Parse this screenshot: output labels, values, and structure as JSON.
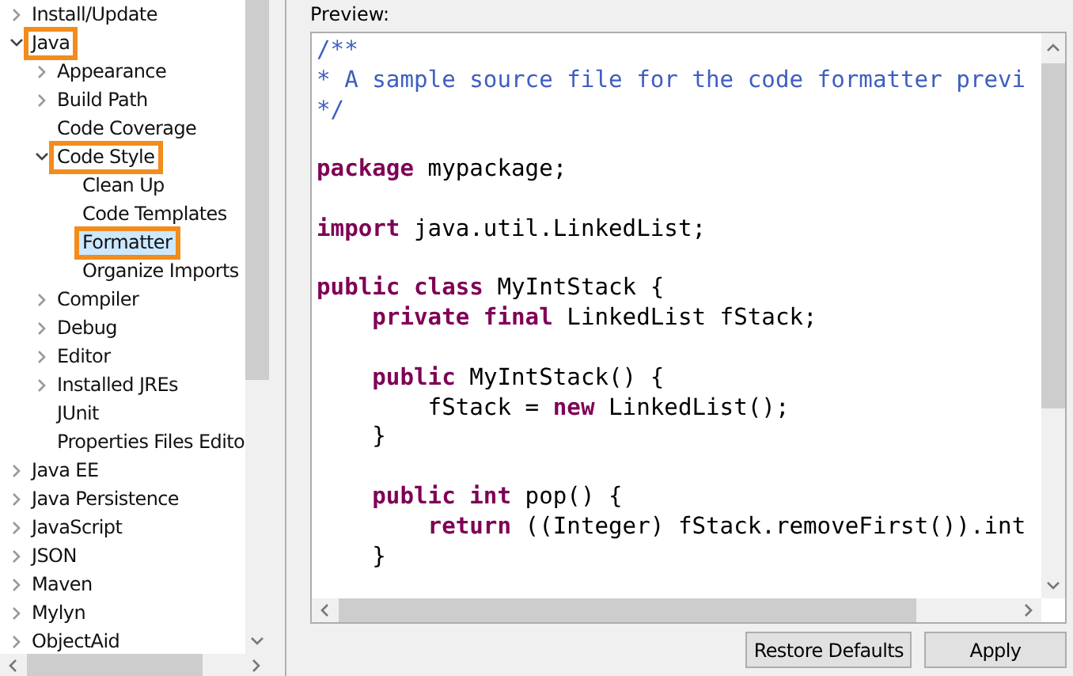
{
  "tree": [
    {
      "label": "Install/Update",
      "expanded": false,
      "selected": false,
      "highlighted": false
    },
    {
      "label": "Java",
      "expanded": true,
      "selected": false,
      "highlighted": true,
      "children": [
        {
          "label": "Appearance",
          "expanded": false,
          "selected": false,
          "highlighted": false
        },
        {
          "label": "Build Path",
          "expanded": false,
          "selected": false,
          "highlighted": false
        },
        {
          "label": "Code Coverage",
          "selected": false,
          "highlighted": false
        },
        {
          "label": "Code Style",
          "expanded": true,
          "selected": false,
          "highlighted": true,
          "children": [
            {
              "label": "Clean Up",
              "selected": false,
              "highlighted": false
            },
            {
              "label": "Code Templates",
              "selected": false,
              "highlighted": false
            },
            {
              "label": "Formatter",
              "selected": true,
              "highlighted": true
            },
            {
              "label": "Organize Imports",
              "selected": false,
              "highlighted": false
            }
          ]
        },
        {
          "label": "Compiler",
          "expanded": false,
          "selected": false,
          "highlighted": false
        },
        {
          "label": "Debug",
          "expanded": false,
          "selected": false,
          "highlighted": false
        },
        {
          "label": "Editor",
          "expanded": false,
          "selected": false,
          "highlighted": false
        },
        {
          "label": "Installed JREs",
          "expanded": false,
          "selected": false,
          "highlighted": false
        },
        {
          "label": "JUnit",
          "selected": false,
          "highlighted": false
        },
        {
          "label": "Properties Files Edito",
          "selected": false,
          "highlighted": false
        }
      ]
    },
    {
      "label": "Java EE",
      "expanded": false,
      "selected": false,
      "highlighted": false
    },
    {
      "label": "Java Persistence",
      "expanded": false,
      "selected": false,
      "highlighted": false
    },
    {
      "label": "JavaScript",
      "expanded": false,
      "selected": false,
      "highlighted": false
    },
    {
      "label": "JSON",
      "expanded": false,
      "selected": false,
      "highlighted": false
    },
    {
      "label": "Maven",
      "expanded": false,
      "selected": false,
      "highlighted": false
    },
    {
      "label": "Mylyn",
      "expanded": false,
      "selected": false,
      "highlighted": false
    },
    {
      "label": "ObjectAid",
      "expanded": false,
      "selected": false,
      "highlighted": false
    }
  ],
  "preview": {
    "label": "Preview:",
    "lines": [
      {
        "kind": "code",
        "tokens": [
          {
            "text": "/**",
            "kind": "comment"
          }
        ]
      },
      {
        "kind": "code",
        "tokens": [
          {
            "text": "* A sample source file for the code formatter previ",
            "kind": "comment"
          }
        ]
      },
      {
        "kind": "code",
        "tokens": [
          {
            "text": "*/",
            "kind": "comment"
          }
        ]
      },
      {
        "kind": "blank"
      },
      {
        "kind": "code",
        "tokens": [
          {
            "text": "package",
            "kind": "keyword"
          },
          {
            "text": " mypackage;",
            "kind": "plain"
          }
        ]
      },
      {
        "kind": "blank"
      },
      {
        "kind": "code",
        "tokens": [
          {
            "text": "import",
            "kind": "keyword"
          },
          {
            "text": " java.util.LinkedList;",
            "kind": "plain"
          }
        ]
      },
      {
        "kind": "blank"
      },
      {
        "kind": "code",
        "tokens": [
          {
            "text": "public class",
            "kind": "keyword"
          },
          {
            "text": " MyIntStack {",
            "kind": "plain"
          }
        ]
      },
      {
        "kind": "code",
        "tokens": [
          {
            "text": "    private final",
            "kind": "keyword"
          },
          {
            "text": " LinkedList fStack;",
            "kind": "plain"
          }
        ]
      },
      {
        "kind": "blank"
      },
      {
        "kind": "code",
        "tokens": [
          {
            "text": "    public",
            "kind": "keyword"
          },
          {
            "text": " MyIntStack() {",
            "kind": "plain"
          }
        ]
      },
      {
        "kind": "code",
        "tokens": [
          {
            "text": "        fStack = ",
            "kind": "plain"
          },
          {
            "text": "new",
            "kind": "keyword"
          },
          {
            "text": " LinkedList();",
            "kind": "plain"
          }
        ]
      },
      {
        "kind": "code",
        "tokens": [
          {
            "text": "    }",
            "kind": "plain"
          }
        ]
      },
      {
        "kind": "blank"
      },
      {
        "kind": "code",
        "tokens": [
          {
            "text": "    public int",
            "kind": "keyword"
          },
          {
            "text": " pop() {",
            "kind": "plain"
          }
        ]
      },
      {
        "kind": "code",
        "tokens": [
          {
            "text": "        return",
            "kind": "keyword"
          },
          {
            "text": " ((Integer) fStack.removeFirst()).int",
            "kind": "plain"
          }
        ]
      },
      {
        "kind": "code",
        "tokens": [
          {
            "text": "    }",
            "kind": "plain"
          }
        ]
      }
    ]
  },
  "buttons": [
    {
      "label": "Restore Defaults"
    },
    {
      "label": "Apply"
    }
  ]
}
